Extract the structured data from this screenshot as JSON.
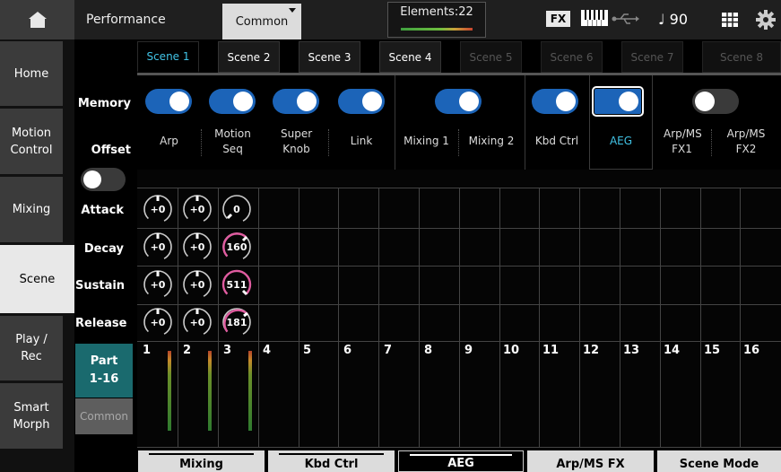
{
  "header": {
    "title": "Performance",
    "common_tab": "Common",
    "elements": "Elements:22",
    "fx_badge": "FX",
    "tempo": "♩ 90"
  },
  "sidebar": {
    "items": [
      {
        "label": "Home"
      },
      {
        "label": "Motion Control"
      },
      {
        "label": "Mixing"
      },
      {
        "label": "Scene"
      },
      {
        "label": "Play / Rec"
      },
      {
        "label": "Smart Morph"
      }
    ],
    "active": "Scene"
  },
  "labels": {
    "memory": "Memory",
    "offset": "Offset",
    "attack": "Attack",
    "decay": "Decay",
    "sustain": "Sustain",
    "release": "Release",
    "part": "Part 1-16",
    "common": "Common"
  },
  "scene_tabs": [
    "Scene 1",
    "Scene 2",
    "Scene 3",
    "Scene 4",
    "Scene 5",
    "Scene 6",
    "Scene 7",
    "Scene 8"
  ],
  "memory_switches": [
    {
      "label": "Arp",
      "on": true
    },
    {
      "label": "Motion Seq",
      "on": true
    },
    {
      "label": "Super Knob",
      "on": true
    },
    {
      "label": "Link",
      "on": true
    },
    {
      "label": "Mixing 1",
      "on": true
    },
    {
      "label": "Mixing 2",
      "on": true
    },
    {
      "label": "Kbd Ctrl",
      "on": true
    },
    {
      "label": "AEG",
      "on": true
    },
    {
      "label": "Arp/MS FX1",
      "on": false
    },
    {
      "label": "Arp/MS FX2",
      "on": false
    }
  ],
  "aeg": {
    "attack": [
      "+0",
      "+0",
      "0"
    ],
    "decay": [
      "+0",
      "+0",
      "160"
    ],
    "sustain": [
      "+0",
      "+0",
      "511"
    ],
    "release": [
      "+0",
      "+0",
      "181"
    ]
  },
  "parts": [
    "1",
    "2",
    "3",
    "4",
    "5",
    "6",
    "7",
    "8",
    "9",
    "10",
    "11",
    "12",
    "13",
    "14",
    "15",
    "16"
  ],
  "bottom_tabs": [
    "Mixing",
    "Kbd Ctrl",
    "AEG",
    "Arp/MS FX",
    "Scene Mode"
  ],
  "bottom_active": "AEG"
}
